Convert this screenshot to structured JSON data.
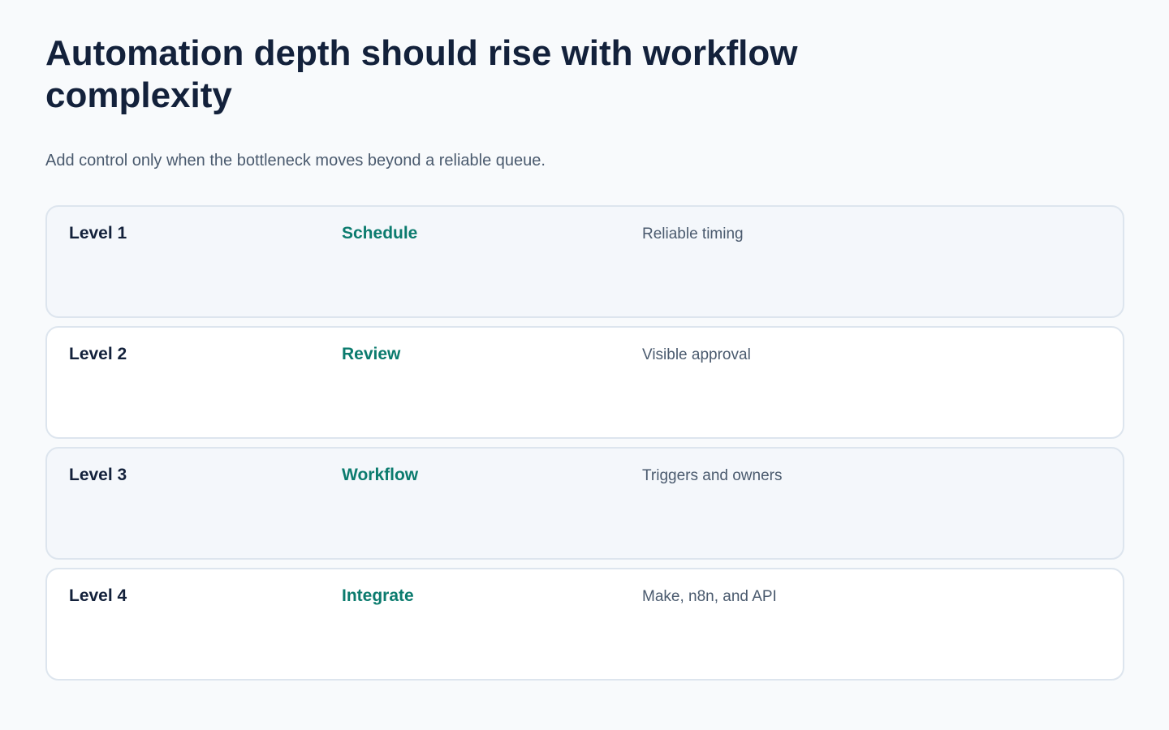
{
  "header": {
    "title": "Automation depth should rise with workflow complexity",
    "subtitle": "Add control only when the bottleneck moves beyond a reliable queue."
  },
  "levels": [
    {
      "level": "Level 1",
      "action": "Schedule",
      "description": "Reliable timing"
    },
    {
      "level": "Level 2",
      "action": "Review",
      "description": "Visible approval"
    },
    {
      "level": "Level 3",
      "action": "Workflow",
      "description": "Triggers and owners"
    },
    {
      "level": "Level 4",
      "action": "Integrate",
      "description": "Make, n8n, and API"
    }
  ],
  "colors": {
    "background": "#f8fafc",
    "title": "#13213b",
    "accent": "#0b7b6e",
    "muted_text": "#4a5a6e",
    "row_border": "#dde5ee",
    "row_alt_bg": "#f4f7fb"
  }
}
